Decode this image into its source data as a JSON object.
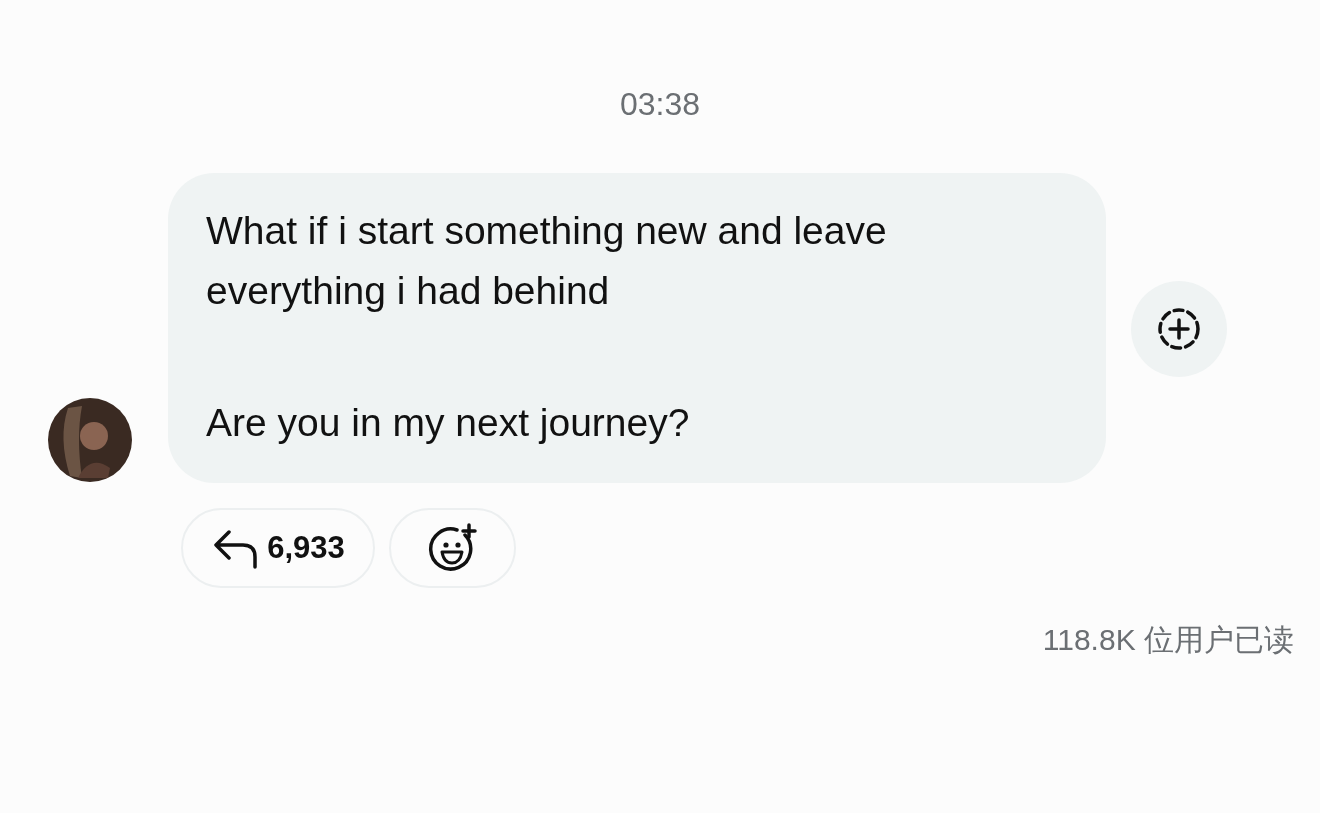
{
  "timestamp": "03:38",
  "message": {
    "paragraphs": [
      "What if i start something new and leave everything i had behind",
      "Are you in my next journey?"
    ]
  },
  "reactions": {
    "reply_count": "6,933"
  },
  "read_count": "118.8K 位用户已读"
}
